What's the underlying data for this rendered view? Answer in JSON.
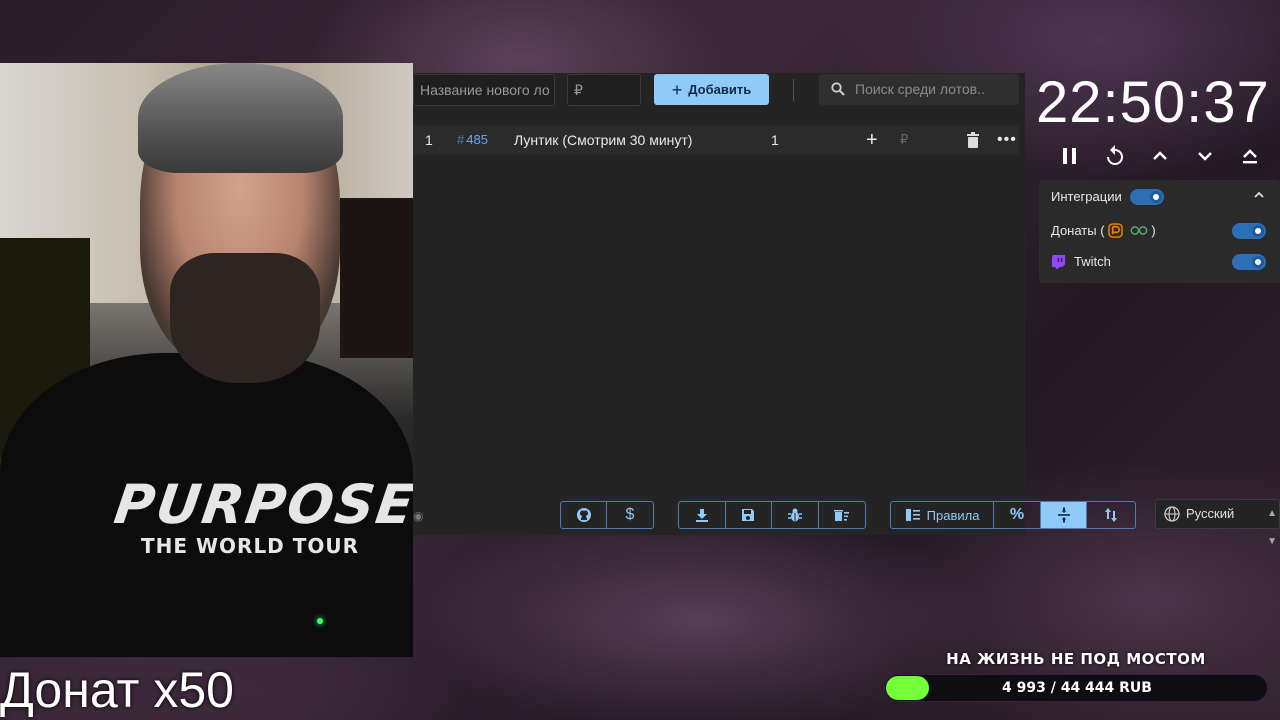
{
  "webcam": {
    "shirt_big": "PURPOSE",
    "shirt_small": "THE WORLD TOUR"
  },
  "overlay": {
    "donate_label": "Донат x50"
  },
  "toolbar": {
    "new_lot_placeholder": "Название нового ло",
    "price_placeholder": "₽",
    "add_label": "Добавить",
    "search_placeholder": "Поиск среди лотов.."
  },
  "lots": [
    {
      "index": "1",
      "tag_hash": "#",
      "tag_id": "485",
      "name": "Лунтик (Смотрим 30 минут)",
      "amount": "1",
      "currency": "₽"
    }
  ],
  "bottom_bar": {
    "rules_label": "Правила",
    "percent_label": "%"
  },
  "language": {
    "selected": "Русский"
  },
  "timer": {
    "value": "22:50:37"
  },
  "integrations": {
    "title": "Интеграции",
    "donations_label": "Донаты (",
    "donations_close": ")",
    "twitch_label": "Twitch",
    "enabled": true
  },
  "goal": {
    "title": "НА ЖИЗНЬ НЕ ПОД МОСТОМ",
    "progress_text": "4 993 / 44 444 RUB",
    "current": 4993,
    "target": 44444,
    "bar_color": "#75ff39"
  },
  "colors": {
    "accent": "#90caf9",
    "toggle": "#2c6fb4",
    "twitch": "#9146ff",
    "donationalerts": "#f57c00"
  }
}
